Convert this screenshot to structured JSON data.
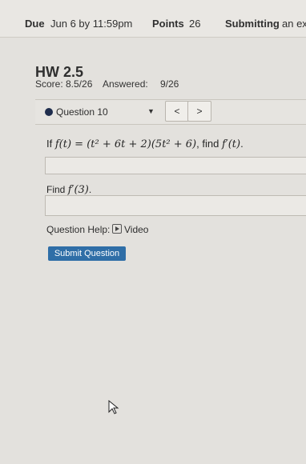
{
  "header": {
    "due_label": "Due",
    "due_date": "Jun 6 by 11:59pm",
    "points_label": "Points",
    "points_value": "26",
    "submitting_label": "Submitting",
    "submitting_extra": "an ex"
  },
  "assignment": {
    "title": "HW 2.5",
    "score_label": "Score:",
    "score_value": "8.5/26",
    "answered_label": "Answered:",
    "answered_value": "9/26"
  },
  "question_nav": {
    "selected": "Question 10",
    "prev_label": "<",
    "next_label": ">"
  },
  "question": {
    "prompt1_prefix": "If",
    "function_def": "f(t) = (t² + 6t + 2)(5t² + 6)",
    "prompt1_middle": ", find",
    "derivative": "f′(t)",
    "prompt1_suffix": ".",
    "prompt2_prefix": "Find",
    "derivative_at": "f′(3)",
    "prompt2_suffix": "."
  },
  "help": {
    "label": "Question Help:",
    "video_label": "Video",
    "icon": "video-icon"
  },
  "actions": {
    "submit_label": "Submit Question"
  },
  "colors": {
    "accent": "#2f6ea7",
    "status_dot": "#1f2d4d"
  }
}
